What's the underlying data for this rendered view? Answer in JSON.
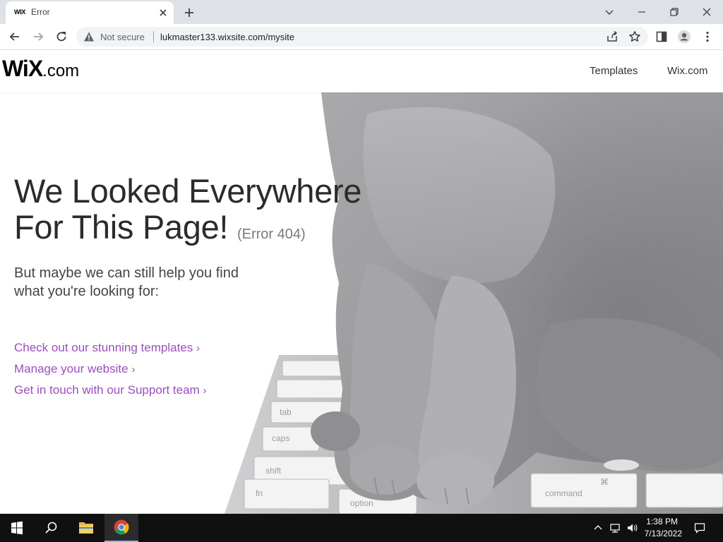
{
  "browser": {
    "tab_favicon_text": "WIX",
    "tab_title": "Error",
    "not_secure_label": "Not secure",
    "url": "lukmaster133.wixsite.com/mysite"
  },
  "header": {
    "logo_main": "WiX",
    "logo_suffix": ".com",
    "nav": [
      {
        "label": "Templates"
      },
      {
        "label": "Wix.com"
      }
    ]
  },
  "main": {
    "headline_line1": "We Looked Everywhere",
    "headline_line2": "For This Page!",
    "error_code": "(Error 404)",
    "subtext_line1": "But maybe we can still help you find",
    "subtext_line2": "what you're looking for:",
    "links": [
      {
        "label": "Check out our stunning templates",
        "chevron": "›"
      },
      {
        "label": "Manage your website",
        "chevron": "›"
      },
      {
        "label": "Get in touch with our Support team",
        "chevron": "›"
      }
    ],
    "keyboard_keys": [
      "tab",
      "caps",
      "shift",
      "fn",
      "option",
      "command",
      "⌘"
    ]
  },
  "taskbar": {
    "time": "1:38 PM",
    "date": "7/13/2022"
  },
  "colors": {
    "link": "#9b4ebd",
    "tabbar_bg": "#dee1e6",
    "taskbar_bg": "#101010",
    "headline": "#2b2b2b"
  },
  "icons": [
    "close-icon",
    "plus-icon",
    "chevron-down-icon",
    "minimize-icon",
    "restore-icon",
    "back-arrow-icon",
    "forward-arrow-icon",
    "reload-icon",
    "warning-icon",
    "share-icon",
    "star-icon",
    "side-panel-icon",
    "profile-icon",
    "kebab-menu-icon",
    "windows-logo-icon",
    "search-icon",
    "folder-icon",
    "chrome-icon",
    "caret-up-icon",
    "network-icon",
    "volume-icon",
    "notification-icon"
  ]
}
